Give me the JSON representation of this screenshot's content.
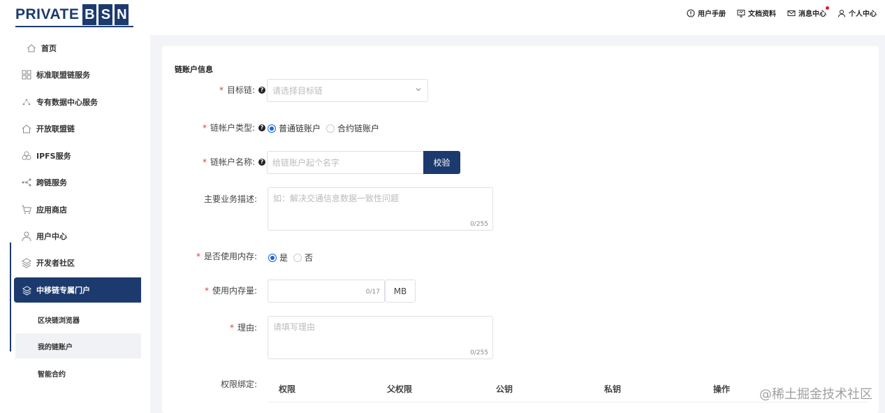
{
  "header": {
    "logo_text": "PRIVATE",
    "logo_letters": [
      "B",
      "S",
      "N"
    ],
    "nav": [
      {
        "label": "用户手册",
        "icon": "info-circle-icon"
      },
      {
        "label": "文档资料",
        "icon": "monitor-icon"
      },
      {
        "label": "消息中心",
        "icon": "mail-icon",
        "badge": true
      },
      {
        "label": "个人中心",
        "icon": "user-icon"
      }
    ]
  },
  "sidebar": {
    "items": [
      {
        "label": "首页",
        "icon": "home-icon"
      },
      {
        "label": "标准联盟链服务",
        "icon": "grid-icon"
      },
      {
        "label": "专有数据中心服务",
        "icon": "nodes-icon"
      },
      {
        "label": "开放联盟链",
        "icon": "house-icon"
      },
      {
        "label": "IPFS服务",
        "icon": "cluster-icon"
      },
      {
        "label": "跨链服务",
        "icon": "network-icon"
      },
      {
        "label": "应用商店",
        "icon": "cart-icon"
      },
      {
        "label": "用户中心",
        "icon": "user-icon"
      },
      {
        "label": "开发者社区",
        "icon": "layers-icon"
      }
    ],
    "active": {
      "label": "中移链专属门户",
      "icon": "layers-icon"
    },
    "sub_items": [
      {
        "label": "区块链浏览器"
      },
      {
        "label": "我的链账户"
      },
      {
        "label": "智能合约"
      }
    ]
  },
  "form": {
    "section_title": "链账户信息",
    "target_chain": {
      "label": "目标链:",
      "placeholder": "请选择目标链"
    },
    "account_type": {
      "label": "链帐户类型:",
      "options": [
        "普通链账户",
        "合约链账户"
      ]
    },
    "account_name": {
      "label": "链帐户名称:",
      "placeholder": "给链账户起个名字",
      "button": "校验"
    },
    "description": {
      "label": "主要业务描述:",
      "placeholder": "如：解决交通信息数据一致性问题",
      "counter": "0/255"
    },
    "use_memory": {
      "label": "是否使用内存:",
      "options": [
        "是",
        "否"
      ]
    },
    "memory_amount": {
      "label": "使用内存量:",
      "counter": "0/17",
      "unit": "MB"
    },
    "reason": {
      "label": "理由:",
      "placeholder": "请填写理由",
      "counter": "0/255"
    },
    "permission": {
      "label": "权限绑定:",
      "columns": [
        "权限",
        "父权限",
        "公钥",
        "私钥",
        "操作"
      ]
    }
  },
  "watermark": "@稀土掘金技术社区",
  "colors": {
    "brand": "#1c3a6e",
    "accent": "#1c63d8",
    "required": "#e23b3b"
  }
}
